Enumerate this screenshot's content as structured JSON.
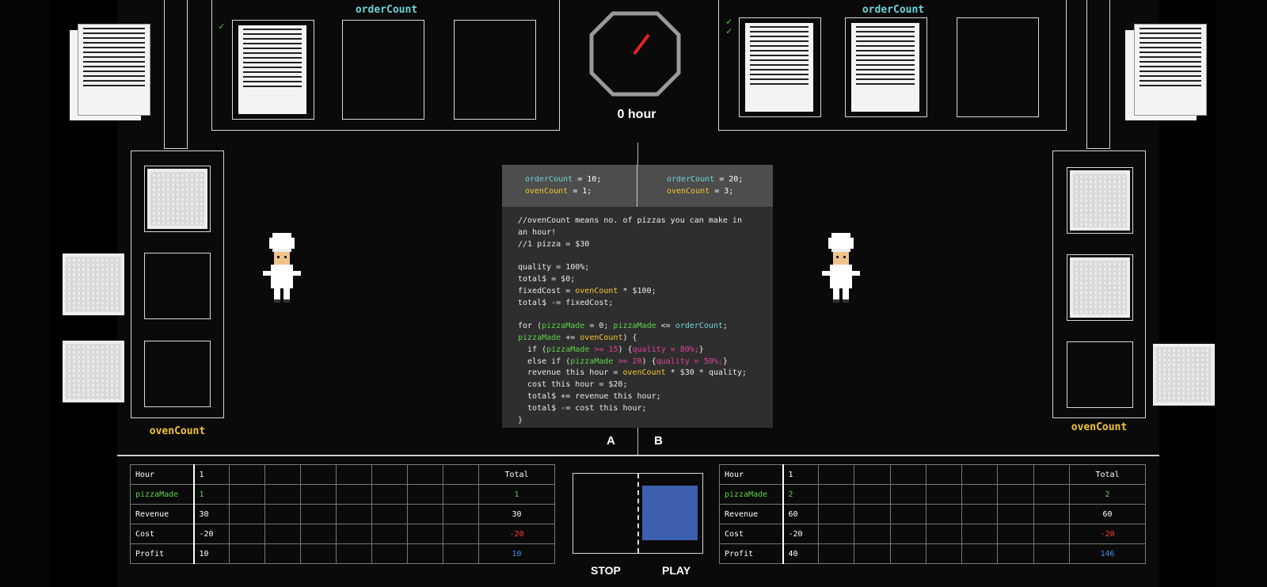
{
  "game": {
    "hour_label": "0 hour",
    "left": {
      "order_label": "orderCount",
      "oven_label": "ovenCount",
      "var_order": "orderCount",
      "var_order_val": " = 10;",
      "var_oven": "ovenCount",
      "var_oven_val": " = 1;",
      "side": "A"
    },
    "right": {
      "order_label": "orderCount",
      "oven_label": "ovenCount",
      "var_order": "orderCount",
      "var_order_val": " = 20;",
      "var_oven": "ovenCount",
      "var_oven_val": " = 3;",
      "side": "B"
    },
    "code": {
      "l1": "//ovenCount means no. of pizzas you can make in",
      "l2": "an hour!",
      "l3": "//1 pizza = $30",
      "l5": "quality = 100%;",
      "l6": "total$ = $0;",
      "l7a": "fixedCost = ",
      "l7b": "ovenCount",
      "l7c": " * $100;",
      "l8": "total$ -= fixedCost;",
      "l10a": "for (",
      "l10b": "pizzaMade",
      "l10c": " = 0; ",
      "l10d": "pizzaMade",
      "l10e": " <= ",
      "l10f": "orderCount",
      "l10g": ";",
      "l11a": "pizzaMade",
      "l11b": " += ",
      "l11c": "ovenCount",
      "l11d": ") {",
      "l12a": "  if (",
      "l12b": "pizzaMade",
      "l12c": " >= 15",
      "l12d": ") {",
      "l12e": "quality = 80%;",
      "l12f": "}",
      "l13a": "  else if (",
      "l13b": "pizzaMade",
      "l13c": " >= 20",
      "l13d": ") {",
      "l13e": "quality = 50%;",
      "l13f": "}",
      "l14a": "  revenue this hour = ",
      "l14b": "ovenCount",
      "l14c": " * $30 * quality;",
      "l15": "  cost this hour = $20;",
      "l16": "  total$ += revenue this hour;",
      "l17": "  total$ -= cost this hour;",
      "l18": "}"
    },
    "controls": {
      "stop_label": "STOP",
      "play_label": "PLAY"
    },
    "table_left": {
      "row_labels": [
        "Hour",
        "pizzaMade",
        "Revenue",
        "Cost",
        "Profit"
      ],
      "first_col": [
        "1",
        "1",
        "30",
        "-20",
        "10"
      ],
      "total_col": [
        "Total",
        "1",
        "30",
        "-20",
        "10"
      ]
    },
    "table_right": {
      "row_labels": [
        "Hour",
        "pizzaMade",
        "Revenue",
        "Cost",
        "Profit"
      ],
      "first_col": [
        "1",
        "2",
        "60",
        "-20",
        "40"
      ],
      "total_col": [
        "Total",
        "2",
        "60",
        "-20",
        "146"
      ]
    },
    "icons": {
      "check": "✓",
      "clock": "clock-icon",
      "chef": "chef-icon",
      "order": "order-sheet-icon",
      "pizza": "pizza-icon"
    },
    "colors": {
      "accent_cyan": "#6fd3d6",
      "accent_yellow": "#f2c534",
      "accent_green": "#5fcf4a",
      "cost_red": "#ff3b30",
      "profit_blue": "#3a8ee8",
      "play_fill": "#3d5fad"
    }
  }
}
